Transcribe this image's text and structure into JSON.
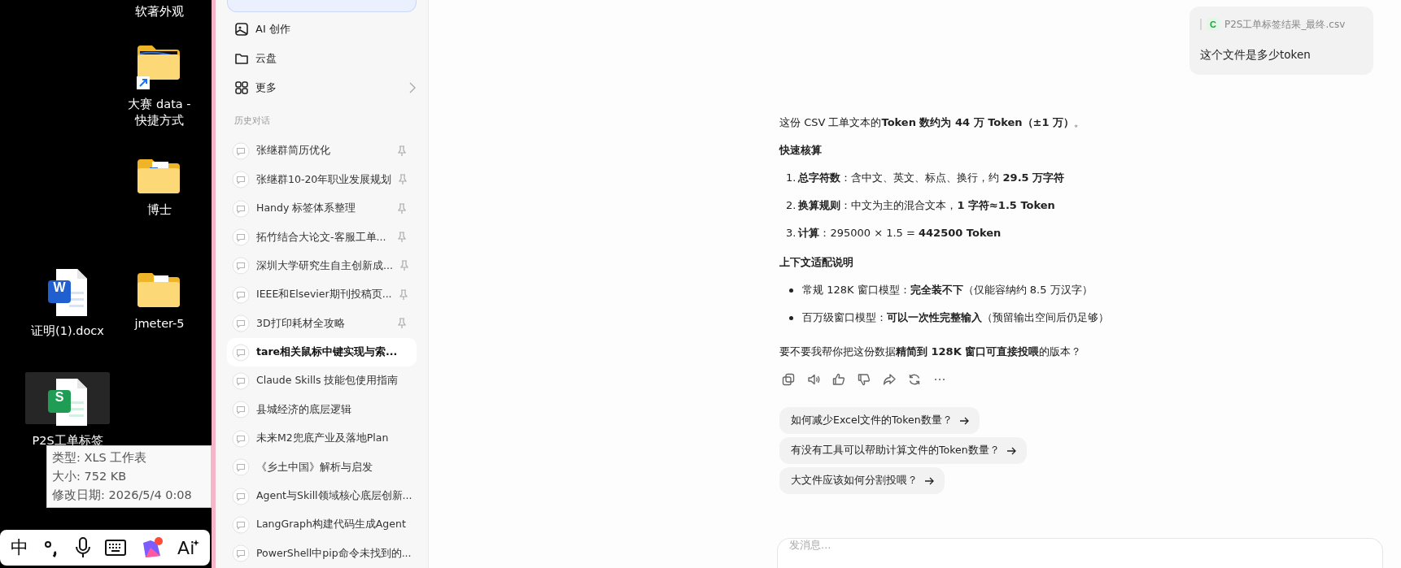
{
  "desktop": {
    "icons": [
      {
        "kind": "none",
        "label": "软著外观",
        "selected": false
      },
      {
        "kind": "folder-shortcut",
        "label": "大赛 data - 快捷方式",
        "selected": false
      },
      {
        "kind": "folder-doc",
        "label": "博士",
        "selected": false
      },
      {
        "kind": "word",
        "glyph": "W",
        "label": "证明(1).docx",
        "selected": false
      },
      {
        "kind": "folder",
        "label": "jmeter-5",
        "selected": false
      },
      {
        "kind": "sheet",
        "glyph": "S",
        "label": "P2S工单标签",
        "selected": true
      }
    ],
    "tooltip": {
      "lines": [
        "类型: XLS 工作表",
        "大小: 752 KB",
        "修改日期: 2026/5/4 0:08"
      ]
    },
    "taskbar": [
      {
        "kind": "text",
        "text": "中"
      },
      {
        "kind": "punct"
      },
      {
        "kind": "mic"
      },
      {
        "kind": "keyboard"
      },
      {
        "kind": "app"
      },
      {
        "kind": "ai",
        "text": "Ai"
      }
    ]
  },
  "sidebar": {
    "nav": [
      {
        "kind": "image",
        "label": "AI 创作",
        "chevron": false
      },
      {
        "kind": "folder",
        "label": "云盘",
        "chevron": false
      },
      {
        "kind": "grid",
        "label": "更多",
        "chevron": true
      }
    ],
    "history_title": "历史对话",
    "history": [
      {
        "title": "张继群简历优化",
        "pinned": true,
        "selected": false
      },
      {
        "title": "张继群10-20年职业发展规划",
        "pinned": true,
        "selected": false
      },
      {
        "title": "Handy 标签体系整理",
        "pinned": true,
        "selected": false
      },
      {
        "title": "拓竹结合大论文-客服工单...",
        "pinned": true,
        "selected": false
      },
      {
        "title": "深圳大学研究生自主创新成...",
        "pinned": true,
        "selected": false
      },
      {
        "title": "IEEE和Elsevier期刊投稿页...",
        "pinned": true,
        "selected": false
      },
      {
        "title": "3D打印耗材全攻略",
        "pinned": true,
        "selected": false
      },
      {
        "title": "tare相关鼠标中键实现与索...",
        "pinned": false,
        "selected": true
      },
      {
        "title": "Claude Skills 技能包使用指南",
        "pinned": false,
        "selected": false
      },
      {
        "title": "县城经济的底层逻辑",
        "pinned": false,
        "selected": false
      },
      {
        "title": "未来M2兜底产业及落地Plan",
        "pinned": false,
        "selected": false
      },
      {
        "title": "《乡土中国》解析与启发",
        "pinned": false,
        "selected": false
      },
      {
        "title": "Agent与Skill领域核心底层创新...",
        "pinned": false,
        "selected": false
      },
      {
        "title": "LangGraph构建代码生成Agent",
        "pinned": false,
        "selected": false
      },
      {
        "title": "PowerShell中pip命令未找到的...",
        "pinned": false,
        "selected": false
      }
    ]
  },
  "chat": {
    "user_message": {
      "file": {
        "badge": "C",
        "name": "P2S工单标签结果_最终.csv"
      },
      "text": "这个文件是多少token"
    },
    "answer": [
      {
        "kind": "paragraph",
        "text": "这份 CSV 工单文本的**Token 数约为 44 万 Token（±1 万）**。"
      },
      {
        "kind": "heading",
        "text": "快速核算"
      },
      {
        "kind": "ordered",
        "items": [
          {
            "number": "1.",
            "text": "**总字符数**：含中文、英文、标点、换行，约 **29.5 万字符**"
          },
          {
            "number": "2.",
            "text": "**换算规则**：中文为主的混合文本，**1 字符≈1.5 Token**"
          },
          {
            "number": "3.",
            "text": "**计算**：295000 × 1.5 = **442500 Token**"
          }
        ]
      },
      {
        "kind": "heading",
        "text": "上下文适配说明"
      },
      {
        "kind": "bullets",
        "items": [
          "常规 128K 窗口模型：**完全装不下**（仅能容纳约 8.5 万汉字）",
          "百万级窗口模型：**可以一次性完整输入**（预留输出空间后仍足够）"
        ]
      },
      {
        "kind": "paragraph",
        "text": "要不要我帮你把这份数据**精简到 128K 窗口可直接投喂**的版本？"
      }
    ],
    "actions": [
      {
        "kind": "copy"
      },
      {
        "kind": "speaker"
      },
      {
        "kind": "like"
      },
      {
        "kind": "dislike"
      },
      {
        "kind": "share"
      },
      {
        "kind": "regenerate"
      },
      {
        "kind": "more"
      }
    ],
    "suggestions": [
      "如何减少Excel文件的Token数量？",
      "有没有工具可以帮助计算文件的Token数量？",
      "大文件应该如何分割投喂？"
    ],
    "input": {
      "placeholder": "发消息..."
    }
  }
}
